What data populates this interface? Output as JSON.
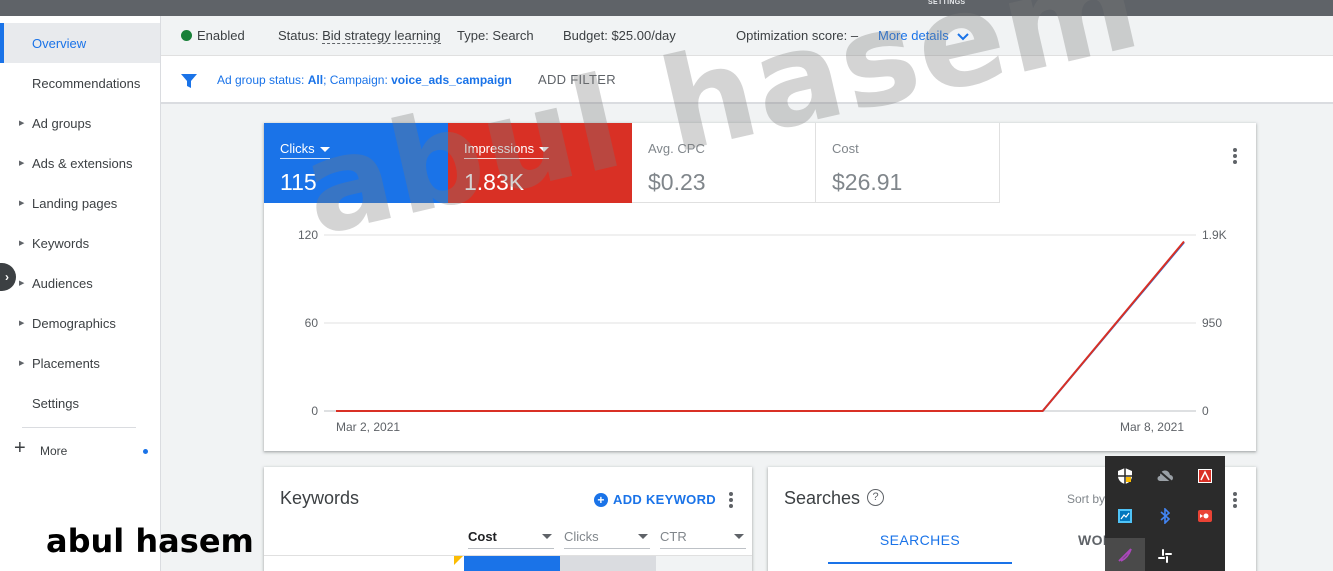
{
  "topbar": {
    "settings_label": "SETTINGS"
  },
  "sidebar": {
    "items": [
      {
        "label": "Overview",
        "expandable": false,
        "active": true
      },
      {
        "label": "Recommendations",
        "expandable": false
      },
      {
        "label": "Ad groups",
        "expandable": true
      },
      {
        "label": "Ads & extensions",
        "expandable": true
      },
      {
        "label": "Landing pages",
        "expandable": true
      },
      {
        "label": "Keywords",
        "expandable": true
      },
      {
        "label": "Audiences",
        "expandable": true
      },
      {
        "label": "Demographics",
        "expandable": true
      },
      {
        "label": "Placements",
        "expandable": true
      },
      {
        "label": "Settings",
        "expandable": false
      }
    ],
    "more_label": "More"
  },
  "status": {
    "enabled": "Enabled",
    "status_label": "Status:",
    "status_value": "Bid strategy learning",
    "type_label": "Type:",
    "type_value": "Search",
    "budget_label": "Budget:",
    "budget_value": "$25.00/day",
    "opt_label": "Optimization score:",
    "opt_value": "–",
    "more_details": "More details"
  },
  "filter": {
    "prefix1": "Ad group status: ",
    "value1": "All",
    "sep": "; Campaign: ",
    "value2": "voice_ads_campaign",
    "add_filter": "ADD FILTER"
  },
  "metrics": [
    {
      "name": "Clicks",
      "value": "115",
      "selected": true,
      "color": "#1a73e8"
    },
    {
      "name": "Impressions",
      "value": "1.83K",
      "selected": true,
      "color": "#d93025"
    },
    {
      "name": "Avg. CPC",
      "value": "$0.23",
      "selected": false
    },
    {
      "name": "Cost",
      "value": "$26.91",
      "selected": false
    }
  ],
  "chart_data": {
    "type": "line",
    "x": [
      "Mar 2, 2021",
      "Mar 3, 2021",
      "Mar 4, 2021",
      "Mar 5, 2021",
      "Mar 6, 2021",
      "Mar 7, 2021",
      "Mar 8, 2021"
    ],
    "x_tick_labels": [
      "Mar 2, 2021",
      "Mar 8, 2021"
    ],
    "series": [
      {
        "name": "Clicks",
        "axis": "left",
        "color": "#1a73e8",
        "values": [
          0,
          0,
          0,
          0,
          0,
          0,
          115
        ]
      },
      {
        "name": "Impressions",
        "axis": "right",
        "color": "#d93025",
        "values": [
          0,
          0,
          0,
          0,
          0,
          0,
          1830
        ]
      }
    ],
    "y_left": {
      "ticks": [
        "0",
        "60",
        "120"
      ],
      "range": [
        0,
        120
      ]
    },
    "y_right": {
      "ticks": [
        "0",
        "950",
        "1.9K"
      ],
      "range": [
        0,
        1900
      ]
    },
    "grid": true
  },
  "keywords_card": {
    "title": "Keywords",
    "add_button": "ADD KEYWORD",
    "columns": [
      "Cost",
      "Clicks",
      "CTR"
    ]
  },
  "searches_card": {
    "title": "Searches",
    "help": "?",
    "sort_by": "Sort by",
    "tabs": [
      "SEARCHES",
      "WOR"
    ]
  },
  "watermark": {
    "large": "abul hasem",
    "small": "abul hasem"
  }
}
